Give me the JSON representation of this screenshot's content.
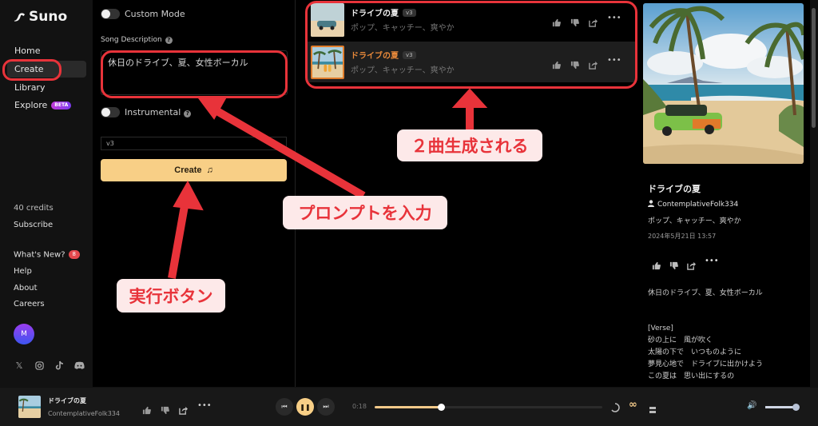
{
  "app": {
    "name": "Suno"
  },
  "sidebar": {
    "nav": [
      {
        "label": "Home"
      },
      {
        "label": "Create",
        "active": true
      },
      {
        "label": "Library"
      },
      {
        "label": "Explore",
        "badge": "BETA"
      }
    ],
    "credits": "40 credits",
    "subscribe": "Subscribe",
    "links": [
      {
        "label": "What's New?",
        "badge": "8"
      },
      {
        "label": "Help"
      },
      {
        "label": "About"
      },
      {
        "label": "Careers"
      }
    ],
    "avatar_initial": "M",
    "socials": [
      "x-icon",
      "instagram-icon",
      "tiktok-icon",
      "discord-icon"
    ]
  },
  "create": {
    "custom_mode_label": "Custom Mode",
    "custom_mode_on": false,
    "song_description_label": "Song Description",
    "help_glyph": "?",
    "song_description_value": "休日のドライブ、夏、女性ボーカル",
    "instrumental_label": "Instrumental",
    "instrumental_on": false,
    "model_value": "v3",
    "create_label": "Create"
  },
  "songs": [
    {
      "title": "ドライブの夏",
      "version": "v3",
      "tags": "ポップ、キャッチー、爽やか",
      "selected": false
    },
    {
      "title": "ドライブの夏",
      "version": "v3",
      "tags": "ポップ、キャッチー、爽やか",
      "selected": true
    }
  ],
  "detail": {
    "title": "ドライブの夏",
    "user": "ContemplativeFolk334",
    "tags": "ポップ、キャッチー、爽やか",
    "date": "2024年5月21日 13:57",
    "prompt": "休日のドライブ、夏、女性ボーカル",
    "lyrics": [
      "[Verse]",
      "砂の上に　風が吹く",
      "太陽の下で　いつものように",
      "夢見心地で　ドライブに出かけよう",
      "この夏は　思い出にするの"
    ]
  },
  "player": {
    "title": "ドライブの夏",
    "artist": "ContemplativeFolk334",
    "elapsed": "0:18",
    "progress_fraction": 0.29,
    "volume_fraction": 1.0,
    "loop_color": "#f2c98a"
  },
  "annotations": {
    "generated": "２曲生成される",
    "prompt": "プロンプトを入力",
    "run": "実行ボタン",
    "color": "#e8333a"
  }
}
